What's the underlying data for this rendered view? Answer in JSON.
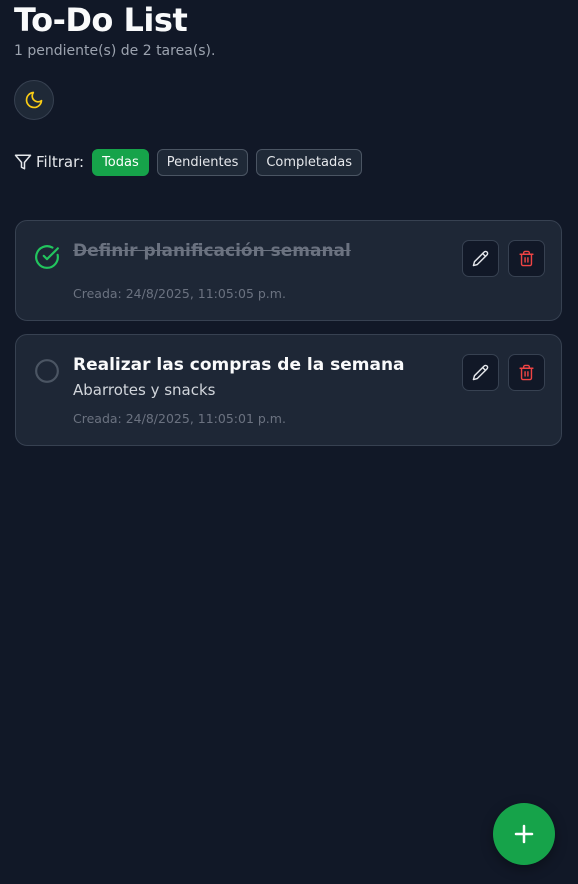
{
  "header": {
    "title": "To-Do List",
    "summary": "1 pendiente(s) de 2 tarea(s)."
  },
  "theme_toggle": {
    "icon": "moon-icon",
    "color": "#facc15"
  },
  "filters": {
    "label": "Filtrar:",
    "options": [
      {
        "label": "Todas",
        "active": true
      },
      {
        "label": "Pendientes",
        "active": false
      },
      {
        "label": "Completadas",
        "active": false
      }
    ]
  },
  "tasks": [
    {
      "title": "Definir planificación semanal",
      "description": "",
      "created": "Creada: 24/8/2025, 11:05:05 p.m.",
      "completed": true
    },
    {
      "title": "Realizar las compras de la semana",
      "description": "Abarrotes y snacks",
      "created": "Creada: 24/8/2025, 11:05:01 p.m.",
      "completed": false
    }
  ],
  "colors": {
    "background": "#111827",
    "card": "#1e2736",
    "accent": "#16a34a",
    "check": "#22c55e",
    "danger": "#ef4444"
  },
  "fab": {
    "icon": "plus-icon"
  }
}
